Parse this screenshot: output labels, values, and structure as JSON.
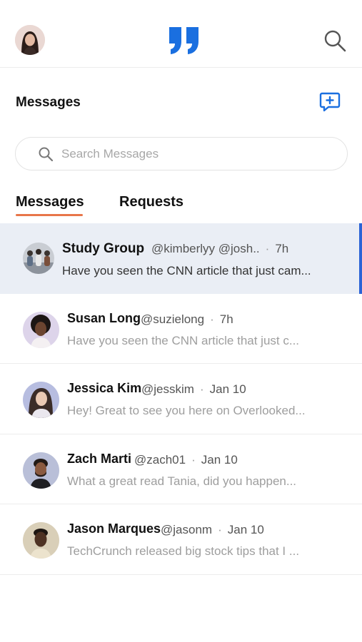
{
  "topbar": {
    "avatar_icon": "profile-avatar",
    "logo_icon": "quote-logo",
    "search_icon": "search-icon",
    "brand_color": "#1a6fe0"
  },
  "header": {
    "title": "Messages",
    "compose_icon": "new-message-icon"
  },
  "search": {
    "placeholder": "Search Messages"
  },
  "tabs": [
    {
      "label": "Messages",
      "active": true
    },
    {
      "label": "Requests",
      "active": false
    }
  ],
  "conversations": [
    {
      "name": "Study Group",
      "handle": "@kimberlyy @josh..",
      "time": "7h",
      "preview": "Have you seen the CNN article that just cam...",
      "active": true
    },
    {
      "name": "Susan Long",
      "handle": "@suzielong",
      "time": "7h",
      "preview": "Have you seen the CNN article that just c..."
    },
    {
      "name": "Jessica Kim",
      "handle": "@jesskim",
      "time": "Jan 10",
      "preview": "Hey! Great to see you here on Overlooked..."
    },
    {
      "name": "Zach Marti",
      "handle": "@zach01",
      "time": "Jan 10",
      "preview": "What a great read Tania, did you happen..."
    },
    {
      "name": "Jason Marques",
      "handle": "@jasonm",
      "time": "Jan 10",
      "preview": "TechCrunch released big stock tips that I ..."
    }
  ],
  "colors": {
    "accent_underline": "#e8764a",
    "active_row_bg": "#eaeef5",
    "active_indicator": "#2c63d6"
  }
}
